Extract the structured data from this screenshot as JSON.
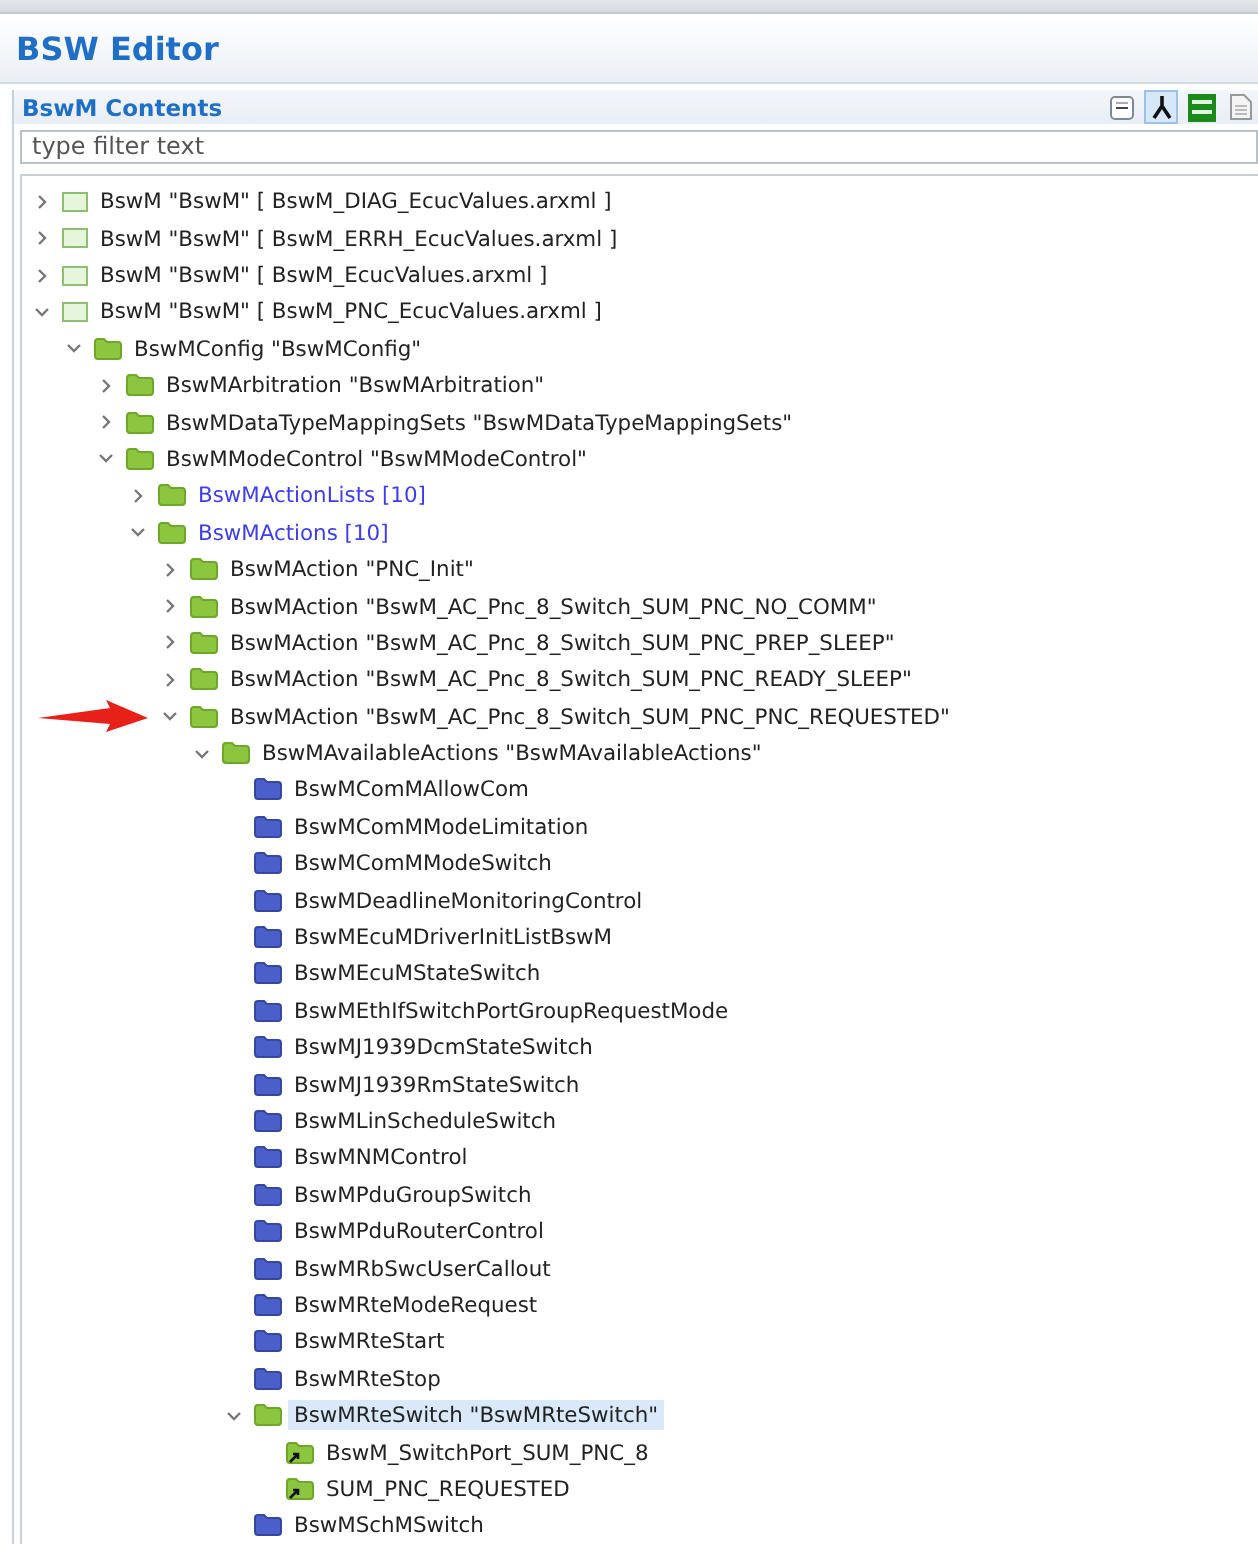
{
  "editor": {
    "title": "BSW Editor"
  },
  "section": {
    "title": "BswM Contents",
    "toolbar": [
      {
        "kind": "collapse",
        "selected": false
      },
      {
        "kind": "fork",
        "selected": true
      },
      {
        "kind": "badge",
        "selected": false
      },
      {
        "kind": "doc",
        "selected": false
      }
    ]
  },
  "filter": {
    "placeholder": "type filter text"
  },
  "tree": [
    {
      "kind": "file",
      "label": "BswM \"BswM\" [ BswM_DIAG_EcucValues.arxml ]",
      "expanded": false
    },
    {
      "kind": "file",
      "label": "BswM \"BswM\" [ BswM_ERRH_EcucValues.arxml ]",
      "expanded": false
    },
    {
      "kind": "file",
      "label": "BswM \"BswM\" [ BswM_EcucValues.arxml ]",
      "expanded": false
    },
    {
      "kind": "file",
      "label": "BswM \"BswM\" [ BswM_PNC_EcucValues.arxml ]",
      "expanded": true,
      "children": [
        {
          "kind": "folder",
          "label": "BswMConfig \"BswMConfig\"",
          "expanded": true,
          "children": [
            {
              "kind": "folder",
              "label": "BswMArbitration \"BswMArbitration\"",
              "expanded": false
            },
            {
              "kind": "folder",
              "label": "BswMDataTypeMappingSets \"BswMDataTypeMappingSets\"",
              "expanded": false
            },
            {
              "kind": "folder",
              "label": "BswMModeControl \"BswMModeControl\"",
              "expanded": true,
              "children": [
                {
                  "kind": "list",
                  "label": "BswMActionLists [10]",
                  "expanded": false
                },
                {
                  "kind": "list",
                  "label": "BswMActions [10]",
                  "expanded": true,
                  "children": [
                    {
                      "kind": "folder",
                      "label": "BswMAction \"PNC_Init\"",
                      "expanded": false
                    },
                    {
                      "kind": "folder",
                      "label": "BswMAction \"BswM_AC_Pnc_8_Switch_SUM_PNC_NO_COMM\"",
                      "expanded": false
                    },
                    {
                      "kind": "folder",
                      "label": "BswMAction \"BswM_AC_Pnc_8_Switch_SUM_PNC_PREP_SLEEP\"",
                      "expanded": false
                    },
                    {
                      "kind": "folder",
                      "label": "BswMAction \"BswM_AC_Pnc_8_Switch_SUM_PNC_READY_SLEEP\"",
                      "expanded": false
                    },
                    {
                      "kind": "folder",
                      "label": "BswMAction \"BswM_AC_Pnc_8_Switch_SUM_PNC_PNC_REQUESTED\"",
                      "expanded": true,
                      "pointer": true,
                      "children": [
                        {
                          "kind": "folder",
                          "label": "BswMAvailableActions \"BswMAvailableActions\"",
                          "expanded": true,
                          "children": [
                            {
                              "kind": "item",
                              "label": "BswMComMAllowCom"
                            },
                            {
                              "kind": "item",
                              "label": "BswMComMModeLimitation"
                            },
                            {
                              "kind": "item",
                              "label": "BswMComMModeSwitch"
                            },
                            {
                              "kind": "item",
                              "label": "BswMDeadlineMonitoringControl"
                            },
                            {
                              "kind": "item",
                              "label": "BswMEcuMDriverInitListBswM"
                            },
                            {
                              "kind": "item",
                              "label": "BswMEcuMStateSwitch"
                            },
                            {
                              "kind": "item",
                              "label": "BswMEthIfSwitchPortGroupRequestMode"
                            },
                            {
                              "kind": "item",
                              "label": "BswMJ1939DcmStateSwitch"
                            },
                            {
                              "kind": "item",
                              "label": "BswMJ1939RmStateSwitch"
                            },
                            {
                              "kind": "item",
                              "label": "BswMLinScheduleSwitch"
                            },
                            {
                              "kind": "item",
                              "label": "BswMNMControl"
                            },
                            {
                              "kind": "item",
                              "label": "BswMPduGroupSwitch"
                            },
                            {
                              "kind": "item",
                              "label": "BswMPduRouterControl"
                            },
                            {
                              "kind": "item",
                              "label": "BswMRbSwcUserCallout"
                            },
                            {
                              "kind": "item",
                              "label": "BswMRteModeRequest"
                            },
                            {
                              "kind": "item",
                              "label": "BswMRteStart"
                            },
                            {
                              "kind": "item",
                              "label": "BswMRteStop"
                            },
                            {
                              "kind": "folder",
                              "label": "BswMRteSwitch \"BswMRteSwitch\"",
                              "expanded": true,
                              "selected": true,
                              "children": [
                                {
                                  "kind": "ref",
                                  "label": "BswM_SwitchPort_SUM_PNC_8"
                                },
                                {
                                  "kind": "ref",
                                  "label": "SUM_PNC_REQUESTED"
                                }
                              ]
                            },
                            {
                              "kind": "item",
                              "label": "BswMSchMSwitch"
                            }
                          ]
                        }
                      ]
                    }
                  ]
                }
              ]
            }
          ]
        }
      ]
    }
  ]
}
